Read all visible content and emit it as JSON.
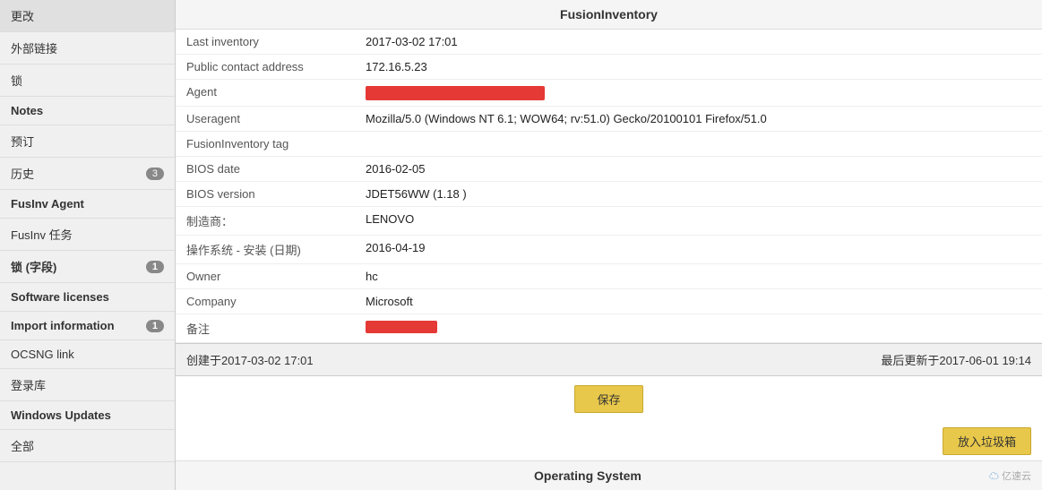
{
  "sidebar": {
    "items": [
      {
        "id": "change",
        "label": "更改",
        "badge": null,
        "active": false,
        "bold": false
      },
      {
        "id": "external-link",
        "label": "外部链接",
        "badge": null,
        "active": false,
        "bold": false
      },
      {
        "id": "lock",
        "label": "锁",
        "badge": null,
        "active": false,
        "bold": false
      },
      {
        "id": "notes",
        "label": "Notes",
        "badge": null,
        "active": false,
        "bold": true
      },
      {
        "id": "reservation",
        "label": "预订",
        "badge": null,
        "active": false,
        "bold": false
      },
      {
        "id": "history",
        "label": "历史",
        "badge": "3",
        "active": false,
        "bold": false
      },
      {
        "id": "fusinv-agent",
        "label": "FusInv Agent",
        "badge": null,
        "active": false,
        "bold": true
      },
      {
        "id": "fusinv-task",
        "label": "FusInv 任务",
        "badge": null,
        "active": false,
        "bold": false
      },
      {
        "id": "lock-field",
        "label": "锁 (字段)",
        "badge": "1",
        "active": false,
        "bold": true
      },
      {
        "id": "software-licenses",
        "label": "Software licenses",
        "badge": null,
        "active": false,
        "bold": true
      },
      {
        "id": "import-information",
        "label": "Import information",
        "badge": "1",
        "active": false,
        "bold": true
      },
      {
        "id": "ocsng-link",
        "label": "OCSNG link",
        "badge": null,
        "active": false,
        "bold": false
      },
      {
        "id": "registry",
        "label": "登录库",
        "badge": null,
        "active": false,
        "bold": false
      },
      {
        "id": "windows-updates",
        "label": "Windows Updates",
        "badge": null,
        "active": false,
        "bold": true
      },
      {
        "id": "all",
        "label": "全部",
        "badge": null,
        "active": false,
        "bold": false
      }
    ]
  },
  "main": {
    "section_title": "FusionInventory",
    "fields": [
      {
        "id": "last-inventory",
        "label": "Last inventory",
        "value": "2017-03-02 17:01",
        "type": "text"
      },
      {
        "id": "public-contact",
        "label": "Public contact address",
        "value": "172.16.5.23",
        "type": "text"
      },
      {
        "id": "agent",
        "label": "Agent",
        "value": "",
        "type": "redacted"
      },
      {
        "id": "useragent",
        "label": "Useragent",
        "value": "Mozilla/5.0 (Windows NT 6.1; WOW64; rv:51.0) Gecko/20100101 Firefox/51.0",
        "type": "text"
      },
      {
        "id": "fusinventory-tag",
        "label": "FusionInventory tag",
        "value": "",
        "type": "text"
      },
      {
        "id": "bios-date",
        "label": "BIOS date",
        "value": "2016-02-05",
        "type": "text"
      },
      {
        "id": "bios-version",
        "label": "BIOS version",
        "value": "JDET56WW (1.18 )",
        "type": "text"
      },
      {
        "id": "manufacturer",
        "label": "制造商：",
        "value": "LENOVO",
        "type": "text"
      },
      {
        "id": "os-install-date",
        "label": "操作系统 - 安装 (日期)",
        "value": "2016-04-19",
        "type": "text"
      },
      {
        "id": "owner",
        "label": "Owner",
        "value": "hc",
        "type": "text"
      },
      {
        "id": "company",
        "label": "Company",
        "value": "Microsoft",
        "type": "text"
      },
      {
        "id": "remarks",
        "label": "备注",
        "value": "",
        "type": "redacted-sm"
      }
    ],
    "footer": {
      "created": "创建于2017-03-02 17:01",
      "updated": "最后更新于2017-06-01 19:14"
    },
    "save_label": "保存",
    "trash_label": "放入垃圾箱",
    "next_section_title": "Operating System",
    "watermark": "亿速云"
  }
}
